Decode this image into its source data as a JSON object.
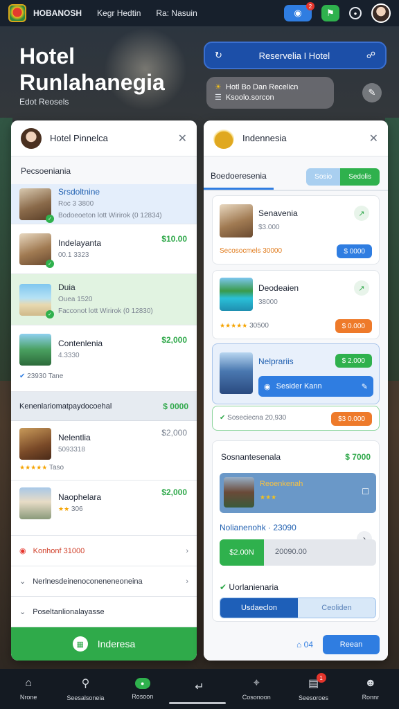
{
  "topbar": {
    "brand": "HOBANOSH",
    "nav": [
      "Kegr Hedtin",
      "Ra: Nasuin"
    ],
    "notif_count": "2"
  },
  "hero": {
    "title_line1": "Hotel",
    "title_line2": "Runlahanegia",
    "subtitle": "Edot Reosels",
    "reserve_label": "Reservelia I Hotel",
    "info_line1": "Hotl Bo Dan Recelicn",
    "info_line2": "Ksoolo.sorcon"
  },
  "left": {
    "header_title": "Hotel Pinnelca",
    "section_label": "Pecsoeniania",
    "hotels": [
      {
        "name": "Srsdoltnine",
        "sub1": "Roc 3 3800",
        "sub2": "Bodoeoeton lott Wirirok (0 12834)",
        "price": ""
      },
      {
        "name": "Indelayanta",
        "sub1": "00.1 3323",
        "sub2": "",
        "price": "$10.00"
      },
      {
        "name": "Duia",
        "sub1": "Ouea 1520",
        "sub2": "Facconot lott Wirirok (0 12830)",
        "price": ""
      },
      {
        "name": "Contenlenia",
        "sub1": "4.3330",
        "sub2": "",
        "price": "$2,000"
      }
    ],
    "rating_row": "23930  Tane",
    "subhead": "Kenenlariomatpaydocoehal",
    "subhead_price": "$ 0000",
    "hotels2": [
      {
        "name": "Nelentlia",
        "sub": "5093318",
        "foot": "Taso",
        "price": "$2,000"
      },
      {
        "name": "Naophelara",
        "sub": "",
        "foot": "306",
        "price": "$2,000"
      }
    ],
    "promo": "Konhonf  31000",
    "line1": "Nerlnesdeinenoconeneneoneina",
    "line2": "Poseltanlionalayasse",
    "cta": "Inderesa"
  },
  "right": {
    "header_title": "Indennesia",
    "tab": "Boedoeresenia",
    "seg": [
      "Sosio",
      "Sedolis"
    ],
    "cards": [
      {
        "name": "Senavenia",
        "sub": "$3.000",
        "foot": "Secosocmels  30000",
        "pill": "$ 0000"
      },
      {
        "name": "Deodeaien",
        "sub": "38000",
        "foot": "30500",
        "pill": "$ 0.000"
      },
      {
        "name": "Nelprariis",
        "inline": "Sesider Kann",
        "pill": "$ 2.000"
      },
      {
        "foot": "Soseciecna  20,930",
        "pill": "$3 0.000"
      }
    ],
    "section_title": "Sosnantesenala",
    "section_price": "$ 7000",
    "dest_name": "Reoenkenah",
    "row_label": "Nolianenohk · 23090",
    "bar_btn": "$2.00N",
    "bar_text": "20090.00",
    "row2_label": "Uorlanienaria",
    "seg2": [
      "Usdaeclon",
      "Ceoliden"
    ],
    "foot_count": "04",
    "foot_btn": "Reean"
  },
  "bottom_nav": [
    "Nrone",
    "Seesalsoneia",
    "Rosoon",
    "",
    "Cosonoon",
    "Seesoroes",
    "Ronnr"
  ],
  "bottom_badge": "1"
}
